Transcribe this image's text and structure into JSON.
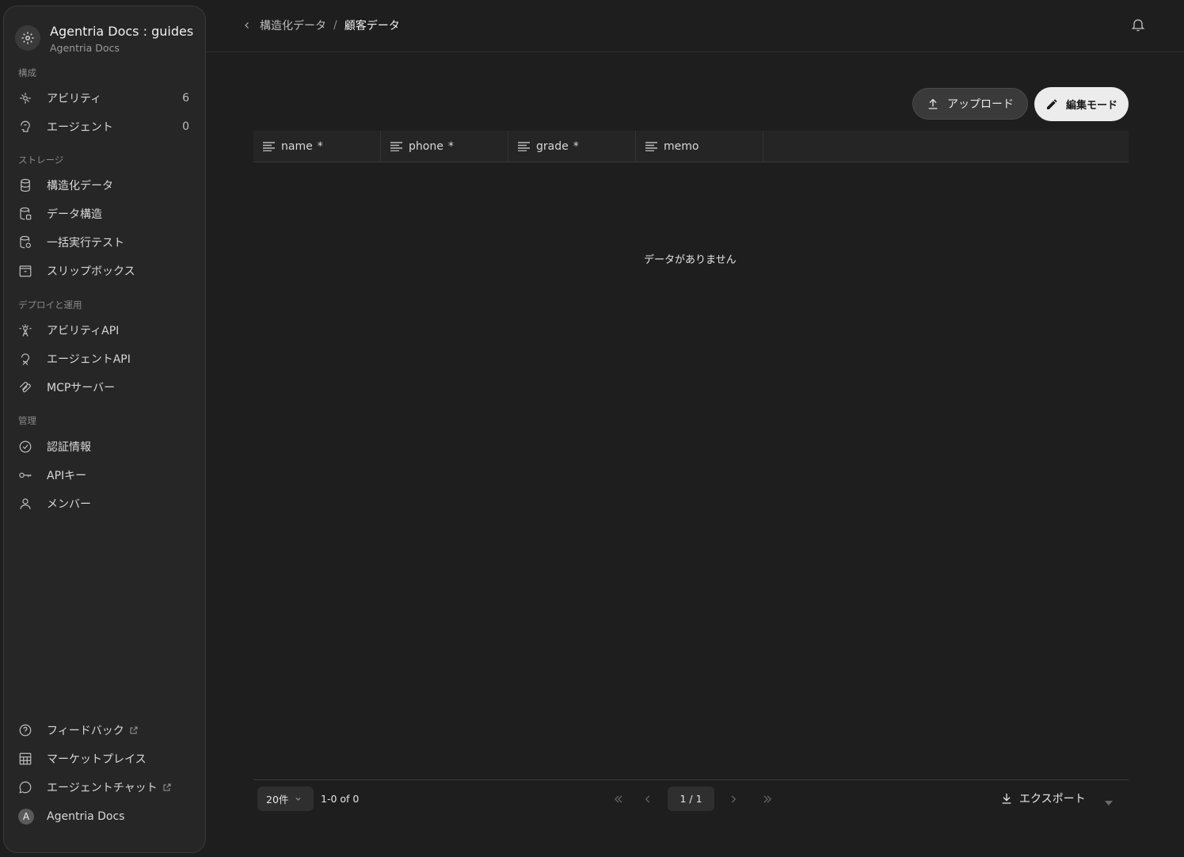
{
  "workspace": {
    "title": "Agentria Docs : guides",
    "subtitle": "Agentria Docs"
  },
  "sidebar": {
    "sections": [
      {
        "label": "構成"
      },
      {
        "label": "ストレージ"
      },
      {
        "label": "デプロイと運用"
      },
      {
        "label": "管理"
      }
    ],
    "items": [
      {
        "label": "アビリティ",
        "count": "6",
        "icon": "ability-icon"
      },
      {
        "label": "エージェント",
        "count": "0",
        "icon": "agent-icon"
      },
      {
        "label": "構造化データ",
        "icon": "database-icon"
      },
      {
        "label": "データ構造",
        "icon": "data-structure-icon"
      },
      {
        "label": "一括実行テスト",
        "icon": "batch-test-icon"
      },
      {
        "label": "スリップボックス",
        "icon": "slipbox-icon"
      },
      {
        "label": "アビリティAPI",
        "icon": "ability-api-icon"
      },
      {
        "label": "エージェントAPI",
        "icon": "agent-api-icon"
      },
      {
        "label": "MCPサーバー",
        "icon": "mcp-icon"
      },
      {
        "label": "認証情報",
        "icon": "credential-icon"
      },
      {
        "label": "APIキー",
        "icon": "key-icon"
      },
      {
        "label": "メンバー",
        "icon": "user-icon"
      }
    ],
    "bottom": [
      {
        "label": "フィードバック",
        "icon": "help-circle-icon",
        "external": true
      },
      {
        "label": "マーケットプレイス",
        "icon": "marketplace-icon"
      },
      {
        "label": "エージェントチャット",
        "icon": "chat-icon",
        "external": true
      },
      {
        "label": "Agentria Docs",
        "avatar": "A"
      }
    ]
  },
  "breadcrumb": {
    "parent": "構造化データ",
    "separator": "/",
    "current": "顧客データ"
  },
  "toolbar": {
    "upload_label": "アップロード",
    "edit_label": "編集モード"
  },
  "table": {
    "columns": [
      {
        "name": "name",
        "required": "*"
      },
      {
        "name": "phone",
        "required": "*"
      },
      {
        "name": "grade",
        "required": "*"
      },
      {
        "name": "memo",
        "required": ""
      }
    ],
    "empty_message": "データがありません"
  },
  "footer": {
    "page_size": "20件",
    "range": "1-0 of 0",
    "page_indicator": "1 / 1",
    "export_label": "エクスポート"
  }
}
